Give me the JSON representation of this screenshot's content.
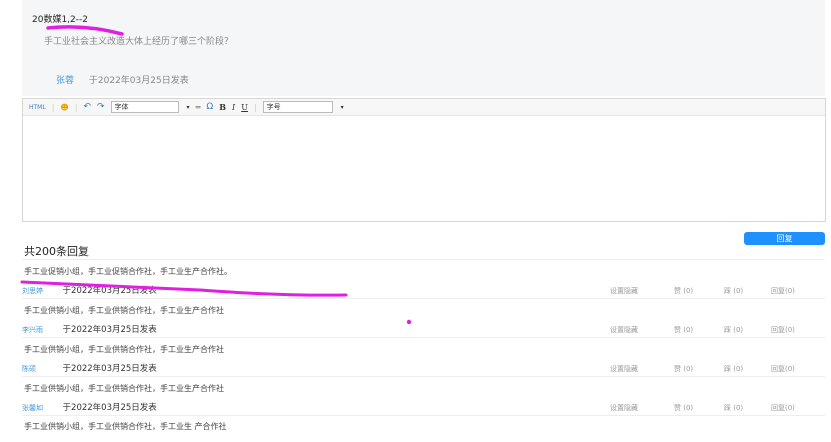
{
  "post": {
    "title": "20数媒1,2--2",
    "question": "手工业社会主义改造大体上经历了哪三个阶段？",
    "author": "张蓉",
    "date": "于2022年03月25日发表"
  },
  "toolbar": {
    "html_label": "HTML",
    "font_placeholder": "字体",
    "size_placeholder": "字号",
    "bold": "B",
    "italic": "I",
    "underline": "U",
    "omega": "Ω"
  },
  "reply_button": "回复",
  "reply_count": "共200条回复",
  "replies": [
    {
      "text": "手工业促销小组，手工业促销合作社，手工业生产合作社。",
      "author": "刘思婷",
      "date": "于2022年03月25日发表"
    },
    {
      "text": "手工业供销小组，手工业供销合作社，手工业生产合作社",
      "author": "李兴雨",
      "date": "于2022年03月25日发表"
    },
    {
      "text": "手工业供销小组，手工业供销合作社，手工业生产合作社",
      "author": "陈硕",
      "date": "于2022年03月25日发表"
    },
    {
      "text": "手工业供销小组，手工业供销合作社，手工业生产合作社",
      "author": "张馨如",
      "date": "于2022年03月25日发表"
    }
  ],
  "actions": {
    "hide": "设置隐藏",
    "like": "赞 (0)",
    "tread": "踩 (0)",
    "reply": "回复(0)"
  },
  "last_reply_text": "手工业供销小组，手工业供销合作社，手工业生 产合作社",
  "colors": {
    "accent": "#1e90ff",
    "author": "#4a9ad8",
    "annotation": "#e020e0"
  }
}
